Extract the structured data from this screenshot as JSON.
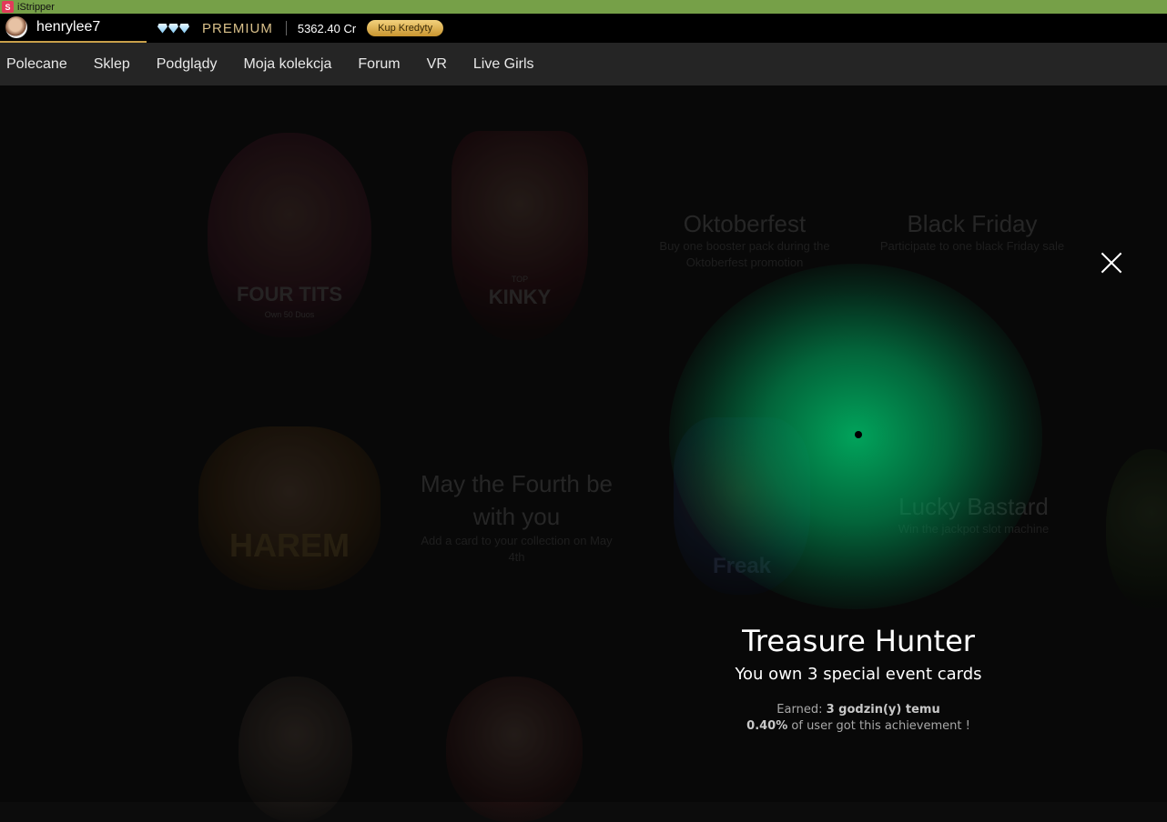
{
  "window": {
    "title": "iStripper"
  },
  "account": {
    "username": "henrylee7",
    "membership": "PREMIUM",
    "credits": "5362.40 Cr",
    "buy_label": "Kup Kredyty"
  },
  "nav": {
    "items": [
      {
        "label": "Polecane"
      },
      {
        "label": "Sklep"
      },
      {
        "label": "Podglądy"
      },
      {
        "label": "Moja kolekcja"
      },
      {
        "label": "Forum"
      },
      {
        "label": "VR"
      },
      {
        "label": "Live Girls"
      }
    ]
  },
  "background_badges": {
    "four_tits": {
      "title": "FOUR TITS",
      "caption": "Own 50 Duos"
    },
    "kinky": {
      "title": "KINKY",
      "caption": "TOP"
    },
    "harem": {
      "title": "HAREM"
    },
    "freak": {
      "title": "Freak"
    },
    "oktoberfest": {
      "title": "Oktoberfest",
      "desc": "Buy one booster pack during the Oktoberfest promotion"
    },
    "black_friday": {
      "title": "Black Friday",
      "desc": "Participate to one black Friday sale"
    },
    "may_fourth": {
      "title": "May the Fourth be with you",
      "desc": "Add a card to your collection on May 4th"
    },
    "lucky_bastard": {
      "title": "Lucky Bastard",
      "desc": "Win the jackpot slot machine"
    }
  },
  "achievement": {
    "title": "Treasure Hunter",
    "subtitle": "You own 3 special event cards",
    "earned_label": "Earned:",
    "earned_value": "3 godzin(y) temu",
    "percent": "0.40%",
    "percent_suffix": "of user got this achievement !"
  },
  "colors": {
    "titlebar": "#76a048",
    "glow": "#00b464",
    "premium_gold": "#d9c08a"
  }
}
